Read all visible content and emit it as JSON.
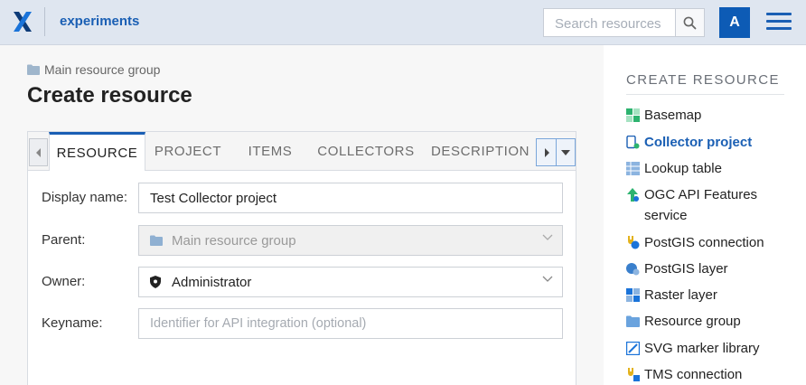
{
  "header": {
    "app_name": "experiments",
    "search_placeholder": "Search resources",
    "avatar_letter": "A"
  },
  "breadcrumb": {
    "parent": "Main resource group"
  },
  "page_title": "Create resource",
  "tabs": [
    {
      "label": "RESOURCE",
      "active": true
    },
    {
      "label": "PROJECT",
      "active": false
    },
    {
      "label": "ITEMS",
      "active": false
    },
    {
      "label": "COLLECTORS",
      "active": false
    },
    {
      "label": "DESCRIPTION",
      "active": false
    }
  ],
  "form": {
    "display_name": {
      "label": "Display name:",
      "value": "Test Collector project"
    },
    "parent": {
      "label": "Parent:",
      "value": "Main resource group"
    },
    "owner": {
      "label": "Owner:",
      "value": "Administrator"
    },
    "keyname": {
      "label": "Keyname:",
      "placeholder": "Identifier for API integration (optional)"
    }
  },
  "sidebar": {
    "title": "CREATE RESOURCE",
    "items": [
      {
        "label": "Basemap",
        "icon": "basemap-icon"
      },
      {
        "label": "Collector project",
        "icon": "collector-project-icon",
        "active": true
      },
      {
        "label": "Lookup table",
        "icon": "lookup-table-icon"
      },
      {
        "label": "OGC API Features service",
        "icon": "ogc-api-icon"
      },
      {
        "label": "PostGIS connection",
        "icon": "postgis-connection-icon"
      },
      {
        "label": "PostGIS layer",
        "icon": "postgis-layer-icon"
      },
      {
        "label": "Raster layer",
        "icon": "raster-layer-icon"
      },
      {
        "label": "Resource group",
        "icon": "folder-icon"
      },
      {
        "label": "SVG marker library",
        "icon": "svg-marker-library-icon"
      },
      {
        "label": "TMS connection",
        "icon": "tms-connection-icon"
      }
    ]
  },
  "colors": {
    "accent": "#1a5fb4",
    "header_bg": "#dfe6f0",
    "avatar_bg": "#0d5bb5"
  }
}
